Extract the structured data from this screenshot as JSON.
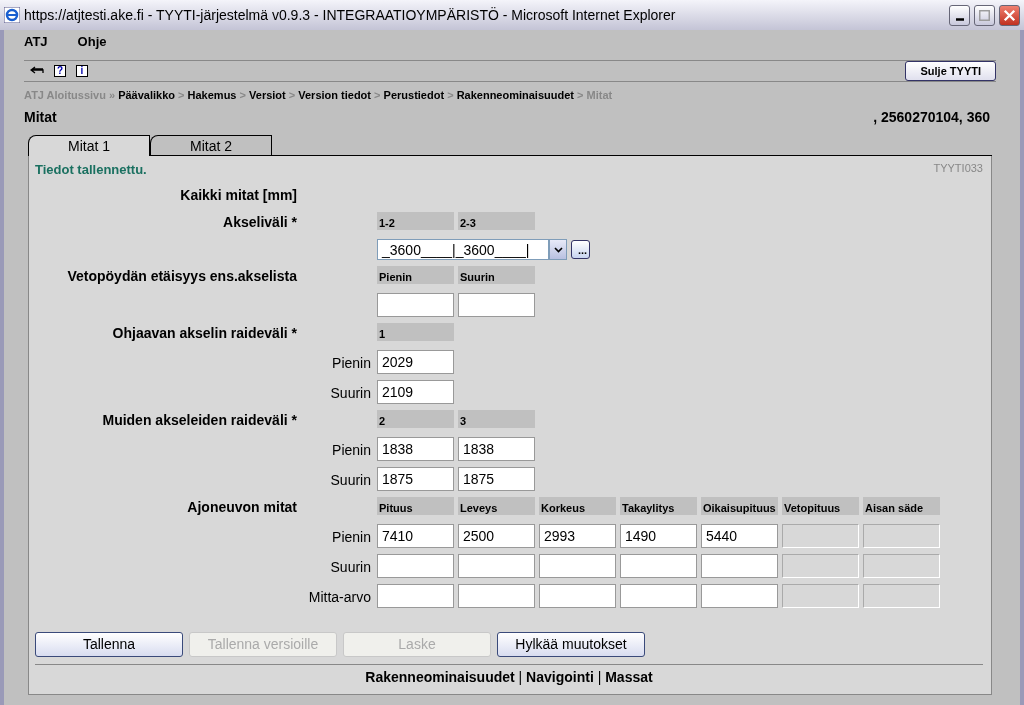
{
  "window": {
    "title": "https://atjtesti.ake.fi - TYYTI-järjestelmä v0.9.3 - INTEGRAATIOYMPÄRISTÖ - Microsoft Internet Explorer"
  },
  "menu": [
    "ATJ",
    "Ohje"
  ],
  "toolbar": [
    {
      "kind": "back"
    },
    {
      "kind": "help",
      "label": "?"
    },
    {
      "kind": "info",
      "label": "i"
    }
  ],
  "close_button": "Sulje TYYTI",
  "breadcrumb": [
    {
      "label": "ATJ Aloitussivu",
      "kind": "home"
    },
    {
      "separator": "»",
      "label": "Päävalikko",
      "kind": "link"
    },
    {
      "separator": ">",
      "label": "Hakemus",
      "kind": "link"
    },
    {
      "separator": ">",
      "label": "Versiot",
      "kind": "link"
    },
    {
      "separator": ">",
      "label": "Version tiedot",
      "kind": "link"
    },
    {
      "separator": ">",
      "label": "Perustiedot",
      "kind": "link"
    },
    {
      "separator": ">",
      "label": "Rakenneominaisuudet",
      "kind": "link"
    },
    {
      "separator": ">",
      "label": "Mitat",
      "kind": "current"
    }
  ],
  "page_title": "Mitat",
  "record_info": ", 2560270104, 360",
  "tabs": [
    {
      "label": "Mitat 1",
      "selected": true
    },
    {
      "label": "Mitat 2",
      "selected": false
    }
  ],
  "message": "Tiedot tallennettu.",
  "form_code": "TYYTI033",
  "sections": [
    {
      "kind": "heading",
      "label": "Kaikki mitat [mm]"
    },
    {
      "kind": "select",
      "label": "Akseliväli *",
      "columns": [
        "1-2",
        "2-3"
      ],
      "value": "_3600____|_3600____|",
      "more_button": "..."
    },
    {
      "kind": "grid",
      "label": "Vetopöydän etäisyys ens.akselista",
      "columns": [
        "Pienin",
        "Suurin"
      ],
      "rows": [
        {
          "cells": [
            {
              "disabled": false
            },
            {
              "disabled": false
            }
          ]
        }
      ]
    },
    {
      "kind": "grid",
      "label": "Ohjaavan akselin raideväli *",
      "columns": [
        "1"
      ],
      "rows": [
        {
          "label": "Pienin",
          "cells": [
            {
              "value": "2029",
              "disabled": false
            }
          ]
        },
        {
          "label": "Suurin",
          "cells": [
            {
              "value": "2109",
              "disabled": false
            }
          ]
        }
      ]
    },
    {
      "kind": "grid",
      "label": "Muiden akseleiden raideväli *",
      "columns": [
        "2",
        "3"
      ],
      "rows": [
        {
          "label": "Pienin",
          "cells": [
            {
              "value": "1838",
              "disabled": false
            },
            {
              "value": "1838",
              "disabled": false
            }
          ]
        },
        {
          "label": "Suurin",
          "cells": [
            {
              "value": "1875",
              "disabled": false
            },
            {
              "value": "1875",
              "disabled": false
            }
          ]
        }
      ]
    },
    {
      "kind": "grid",
      "label": "Ajoneuvon mitat",
      "columns": [
        "Pituus",
        "Leveys",
        "Korkeus",
        "Takaylitys",
        "Oikaisupituus",
        "Vetopituus",
        "Aisan säde"
      ],
      "rows": [
        {
          "label": "Pienin",
          "cells": [
            {
              "value": "7410",
              "disabled": false
            },
            {
              "value": "2500",
              "disabled": false
            },
            {
              "value": "2993",
              "disabled": false
            },
            {
              "value": "1490",
              "disabled": false
            },
            {
              "value": "5440",
              "disabled": false
            },
            {
              "disabled": true
            },
            {
              "disabled": true
            }
          ]
        },
        {
          "label": "Suurin",
          "cells": [
            {
              "disabled": false
            },
            {
              "disabled": false
            },
            {
              "disabled": false
            },
            {
              "disabled": false
            },
            {
              "disabled": false
            },
            {
              "disabled": true
            },
            {
              "disabled": true
            }
          ]
        },
        {
          "label": "Mitta-arvo",
          "cells": [
            {
              "disabled": false
            },
            {
              "disabled": false
            },
            {
              "disabled": false
            },
            {
              "disabled": false
            },
            {
              "disabled": false
            },
            {
              "disabled": true
            },
            {
              "disabled": true
            }
          ]
        }
      ]
    }
  ],
  "buttons": [
    {
      "label": "Tallenna",
      "disabled": false
    },
    {
      "label": "Tallenna versioille",
      "disabled": true
    },
    {
      "label": "Laske",
      "disabled": true
    },
    {
      "label": "Hylkää muutokset",
      "disabled": false
    }
  ],
  "footer_links": [
    {
      "label": "Rakenneominaisuudet"
    },
    {
      "separator": "|",
      "label": "Navigointi"
    },
    {
      "separator": "|",
      "label": "Massat"
    }
  ]
}
